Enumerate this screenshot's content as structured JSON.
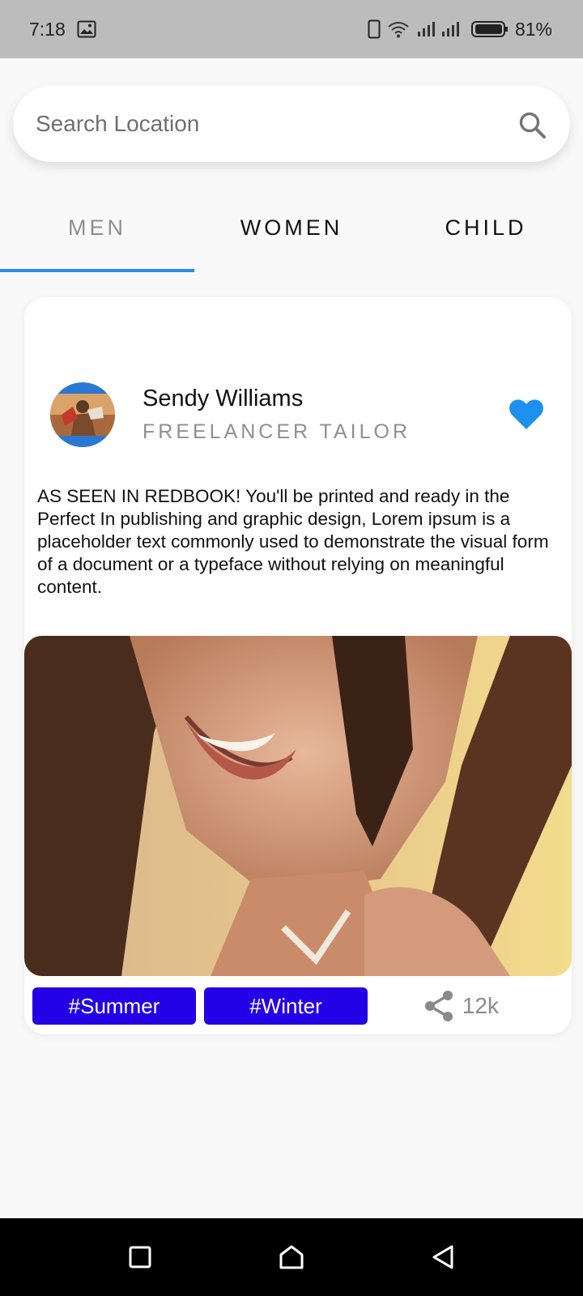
{
  "status_bar": {
    "time": "7:18",
    "battery": "81%",
    "icons": [
      "image-icon",
      "phone-icon",
      "wifi-icon",
      "signal-icon",
      "battery-icon"
    ]
  },
  "search": {
    "placeholder": "Search Location",
    "value": ""
  },
  "tabs": [
    {
      "label": "MEN",
      "active": true
    },
    {
      "label": "WOMEN",
      "active": false
    },
    {
      "label": "CHILD",
      "active": false
    }
  ],
  "post": {
    "author": {
      "name": "Sendy Williams",
      "role": "FREELANCER TAILOR"
    },
    "liked": true,
    "description": "AS SEEN IN REDBOOK! You'll be printed and ready in the Perfect In publishing and graphic design, Lorem ipsum is a placeholder text commonly used to demonstrate the visual form of a document or a typeface without relying on meaningful content.",
    "tags": [
      "#Summer",
      "#Winter"
    ],
    "share_count": "12k"
  },
  "colors": {
    "accent": "#2b8be6",
    "tag_bg": "#2400e6",
    "heart": "#1e90f0"
  }
}
